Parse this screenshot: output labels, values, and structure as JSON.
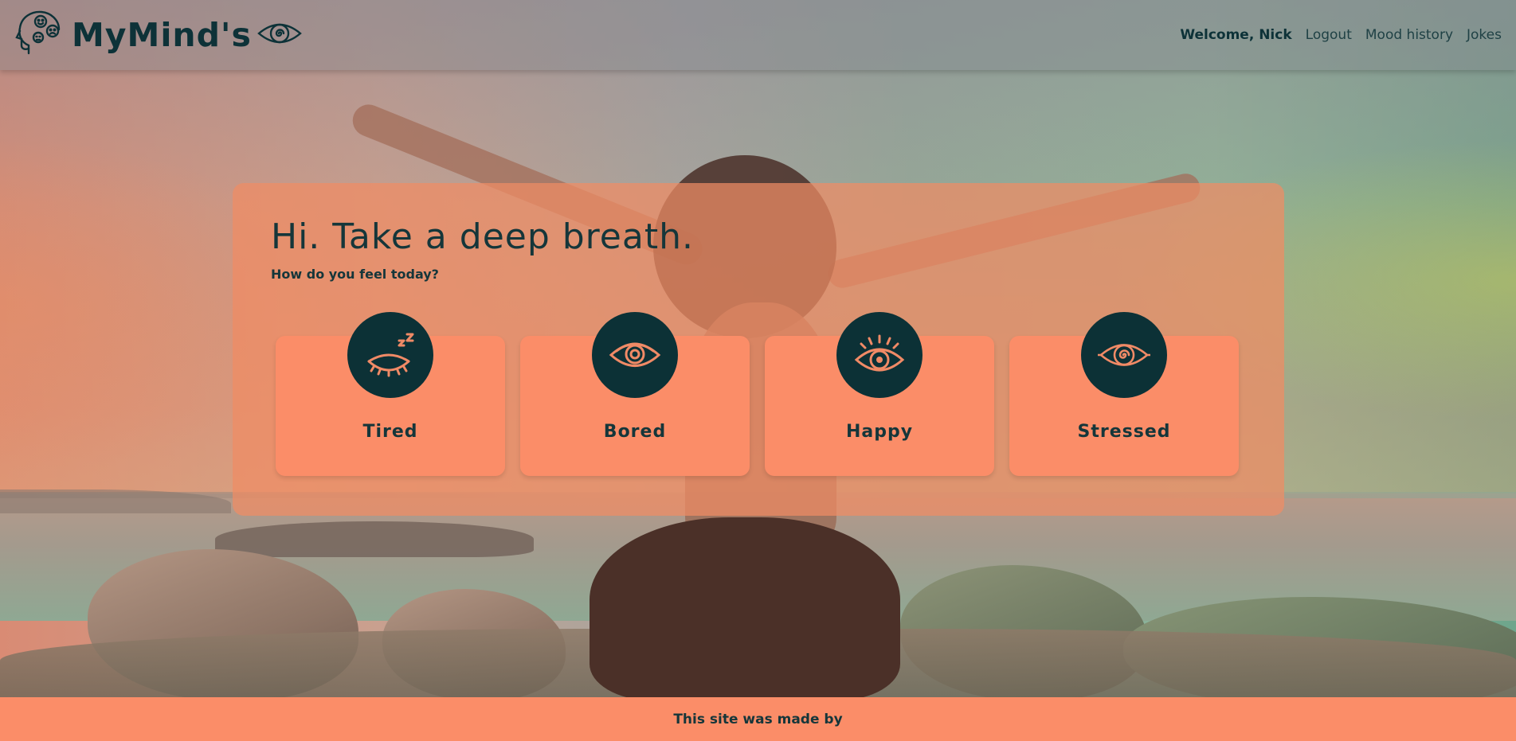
{
  "header": {
    "brand": "MyMind's",
    "welcome": "Welcome, Nick",
    "nav": {
      "logout": "Logout",
      "mood_history": "Mood history",
      "jokes": "Jokes"
    }
  },
  "main": {
    "title": "Hi. Take a deep breath.",
    "subtitle": "How do you feel today?",
    "moods": [
      {
        "label": "Tired",
        "icon": "sleepy-eye-icon"
      },
      {
        "label": "Bored",
        "icon": "eye-icon"
      },
      {
        "label": "Happy",
        "icon": "bright-eye-icon"
      },
      {
        "label": "Stressed",
        "icon": "spiral-eye-icon"
      }
    ]
  },
  "footer": {
    "text": "This site was made by"
  },
  "colors": {
    "accent": "#fb8d68",
    "dark": "#0c3136",
    "icon_stroke": "#f08a66"
  }
}
